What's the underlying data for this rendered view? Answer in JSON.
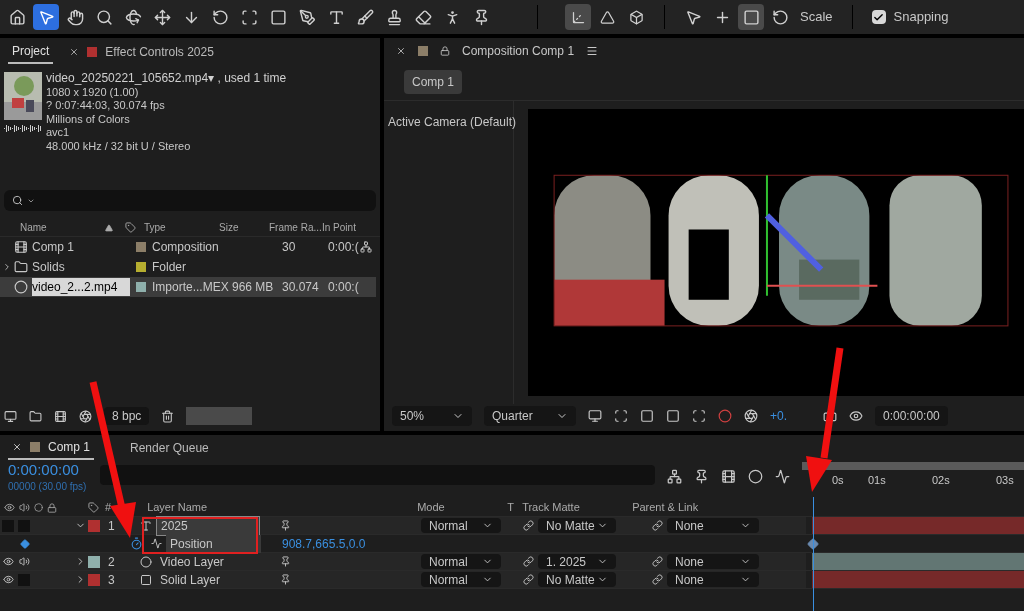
{
  "toolbar": {
    "tools": [
      {
        "selected": false
      },
      {
        "selected": true
      },
      {
        "selected": false
      },
      {
        "selected": false
      },
      {
        "selected": false
      },
      {
        "selected": false
      },
      {
        "selected": false
      },
      {
        "selected": false
      },
      {
        "selected": false
      },
      {
        "selected": false
      },
      {
        "selected": false
      },
      {
        "selected": false
      },
      {
        "selected": false
      },
      {
        "selected": false
      },
      {
        "selected": false
      },
      {
        "selected": false
      },
      {
        "selected": false
      }
    ],
    "axis_modes": [
      {
        "selected": true
      },
      {
        "selected": false
      },
      {
        "selected": false
      }
    ],
    "transform_tools": [
      {
        "selected": false
      },
      {
        "selected": false
      },
      {
        "selected": true
      },
      {
        "selected": false
      }
    ],
    "transform_label": "Scale",
    "snapping": {
      "label": "Snapping",
      "checked": true
    }
  },
  "project": {
    "tabs": [
      {
        "label": "Project",
        "selected": true
      },
      {
        "label": "Effect Controls 2025",
        "selected": false,
        "color": "#b03030"
      }
    ],
    "info": {
      "title": "video_20250221_105652.mp4▾ , used 1 time",
      "lines": [
        "1080 x 1920 (1.00)",
        "? 0:07:44:03, 30.074 fps",
        "Millions of Colors",
        "avc1",
        "48.000 kHz / 32 bit U / Stereo"
      ]
    },
    "columns": [
      "Name",
      "Type",
      "Size",
      "Frame Ra...",
      "In Point"
    ],
    "rows": [
      {
        "kind": "comp",
        "name": "Comp 1",
        "color": "#8c7e68",
        "type": "Composition",
        "size": "",
        "frame_rate": "30",
        "in_point": "0:00:(",
        "selected": false
      },
      {
        "kind": "folder",
        "name": "Solids",
        "color": "#b6ae30",
        "type": "Folder",
        "expanded": false,
        "selected": false
      },
      {
        "kind": "footage",
        "name": "video_2...2.mp4",
        "color": "#8fb0ac",
        "type": "Importe...MEX",
        "size": "966 MB",
        "frame_rate": "30.074",
        "in_point": "0:00:(",
        "selected": true
      }
    ],
    "bit_depth": "8 bpc"
  },
  "composition": {
    "tab": {
      "label": "Composition Comp 1",
      "color": "#8c7e68"
    },
    "breadcrumb": "Comp 1",
    "camera": "Active Camera (Default)",
    "magnification": "50%",
    "resolution": "Quarter",
    "exposure": "+0.",
    "timecode": "0:00:00:00"
  },
  "timeline": {
    "tabs": [
      {
        "label": "Comp 1",
        "selected": true,
        "color": "#8c7e68"
      },
      {
        "label": "Render Queue",
        "selected": false
      }
    ],
    "timecode": "0:00:00:00",
    "frame_info": "00000 (30.00 fps)",
    "columns": [
      "#",
      "Layer Name",
      "Mode",
      "T",
      "Track Matte",
      "Parent & Link"
    ],
    "ruler": [
      "0s",
      "01s",
      "02s",
      "03s"
    ],
    "layers": [
      {
        "number": "1",
        "name": "2025",
        "kind": "text",
        "color": "#b03030",
        "visible": false,
        "audio": false,
        "expanded": true,
        "mode": "Normal",
        "track_matte": "No Matte",
        "parent": "None",
        "properties": [
          {
            "name": "Position",
            "value": "908.7,665.5,0.0",
            "keyframed": true
          }
        ]
      },
      {
        "number": "2",
        "name": "Video Layer",
        "kind": "footage",
        "color": "#8fb0ac",
        "visible": true,
        "audio": true,
        "expanded": false,
        "mode": "Normal",
        "track_matte": "1. 2025",
        "parent": "None"
      },
      {
        "number": "3",
        "name": "Solid Layer",
        "kind": "solid",
        "color": "#b03030",
        "visible": true,
        "audio": false,
        "expanded": false,
        "mode": "Normal",
        "track_matte": "No Matte",
        "parent": "None"
      }
    ]
  }
}
